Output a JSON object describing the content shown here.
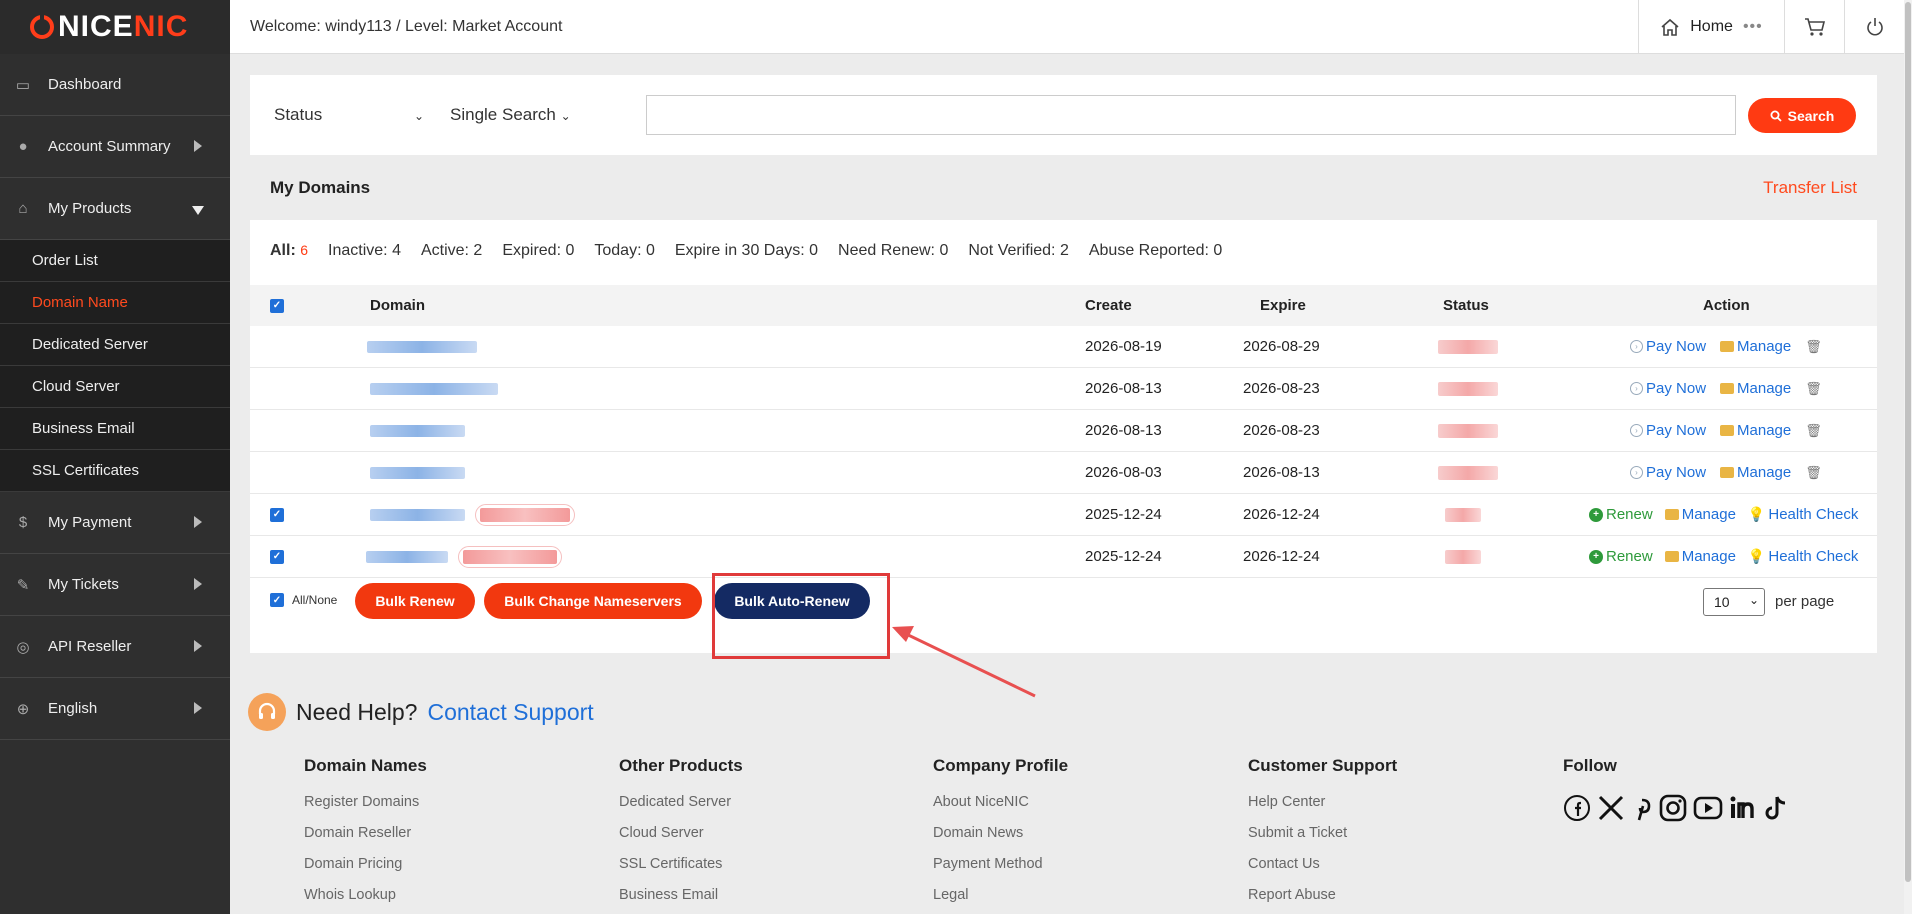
{
  "brand": {
    "logo_white": "NICE",
    "logo_red": "NIC"
  },
  "sidebar": {
    "items": [
      {
        "label": "Dashboard"
      },
      {
        "label": "Account Summary"
      },
      {
        "label": "My Products"
      },
      {
        "label": "My Payment"
      },
      {
        "label": "My Tickets"
      },
      {
        "label": "API Reseller"
      },
      {
        "label": "English"
      }
    ],
    "sub_items": [
      {
        "label": "Order List"
      },
      {
        "label": "Domain Name"
      },
      {
        "label": "Dedicated Server"
      },
      {
        "label": "Cloud Server"
      },
      {
        "label": "Business Email"
      },
      {
        "label": "SSL Certificates"
      }
    ]
  },
  "header": {
    "welcome": "Welcome: windy113  /  Level: Market Account",
    "home": "Home"
  },
  "search": {
    "status_label": "Status",
    "single_label": "Single Search",
    "button": "Search",
    "value": ""
  },
  "domains": {
    "title": "My Domains",
    "transfer_link": "Transfer List",
    "filters": {
      "all_label": "All:",
      "all_count": "6",
      "inactive": "Inactive: 4",
      "active": "Active: 2",
      "expired": "Expired: 0",
      "today": "Today: 0",
      "expire30": "Expire in 30 Days: 0",
      "need_renew": "Need Renew: 0",
      "not_verified": "Not Verified: 2",
      "abuse": "Abuse Reported: 0"
    },
    "columns": {
      "domain": "Domain",
      "create": "Create",
      "expire": "Expire",
      "status": "Status",
      "action": "Action"
    },
    "rows": [
      {
        "create": "2026-08-19",
        "expire": "2026-08-29",
        "pay": "Pay Now",
        "manage": "Manage"
      },
      {
        "create": "2026-08-13",
        "expire": "2026-08-23",
        "pay": "Pay Now",
        "manage": "Manage"
      },
      {
        "create": "2026-08-13",
        "expire": "2026-08-23",
        "pay": "Pay Now",
        "manage": "Manage"
      },
      {
        "create": "2026-08-03",
        "expire": "2026-08-13",
        "pay": "Pay Now",
        "manage": "Manage"
      },
      {
        "create": "2025-12-24",
        "expire": "2026-12-24",
        "renew": "Renew",
        "manage": "Manage",
        "health": "Health Check"
      },
      {
        "create": "2025-12-24",
        "expire": "2026-12-24",
        "renew": "Renew",
        "manage": "Manage",
        "health": "Health Check"
      }
    ],
    "bulk": {
      "all_none": "All/None",
      "renew": "Bulk Renew",
      "change_ns": "Bulk Change Nameservers",
      "auto_renew": "Bulk Auto-Renew",
      "per_page_value": "10",
      "per_page_label": "per page"
    }
  },
  "footer": {
    "help_text": "Need Help?",
    "help_link": "Contact Support",
    "columns": [
      {
        "title": "Domain Names",
        "links": [
          "Register Domains",
          "Domain Reseller",
          "Domain Pricing",
          "Whois Lookup"
        ]
      },
      {
        "title": "Other Products",
        "links": [
          "Dedicated Server",
          "Cloud Server",
          "SSL Certificates",
          "Business Email"
        ]
      },
      {
        "title": "Company Profile",
        "links": [
          "About NiceNIC",
          "Domain News",
          "Payment Method",
          "Legal"
        ]
      },
      {
        "title": "Customer Support",
        "links": [
          "Help Center",
          "Submit a Ticket",
          "Contact Us",
          "Report Abuse"
        ]
      },
      {
        "title": "Follow",
        "links": []
      }
    ]
  },
  "colors": {
    "accent": "#ff3a12",
    "navy": "#142a63",
    "link": "#1f6fd8"
  }
}
